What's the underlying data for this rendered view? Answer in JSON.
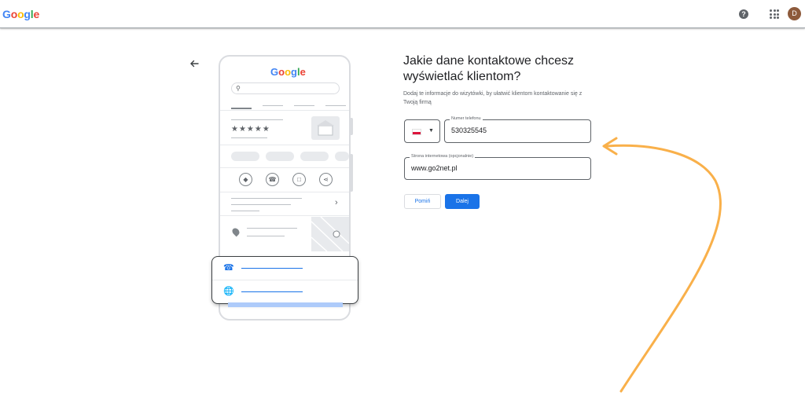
{
  "header": {
    "logo": {
      "letters": [
        "G",
        "o",
        "o",
        "g",
        "l",
        "e"
      ],
      "colors": [
        "#4285F4",
        "#EA4335",
        "#FBBC05",
        "#4285F4",
        "#34A853",
        "#EA4335"
      ]
    },
    "help_icon": "?",
    "avatar_initial": "D"
  },
  "illustration": {
    "logo": "Google",
    "stars": "★★★★★"
  },
  "form": {
    "title": "Jakie dane kontaktowe chcesz wyświetlać klientom?",
    "subtitle": "Dodaj te informacje do wizytówki, by ułatwić klientom kontaktowanie się z Twoją firmą",
    "phone": {
      "label": "Numer telefonu",
      "value": "530325545"
    },
    "website": {
      "label": "Strona internetowa (opcjonalnie)",
      "value": "www.go2net.pl"
    },
    "skip_label": "Pomiń",
    "next_label": "Dalej"
  },
  "colors": {
    "accent": "#1a73e8",
    "annotation_arrow": "#f9b04a"
  }
}
